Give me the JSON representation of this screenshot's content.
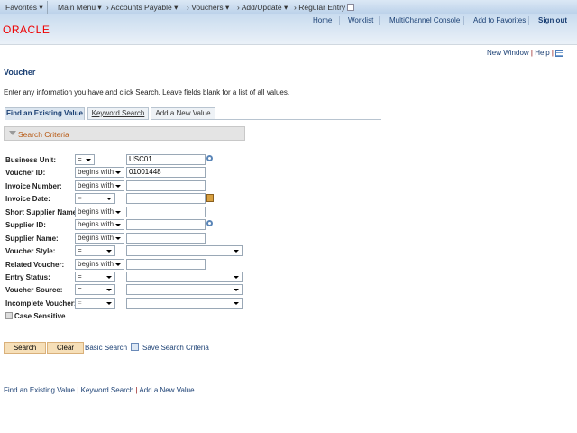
{
  "nav": {
    "favorites": "Favorites",
    "main_menu": "Main Menu",
    "breadcrumb": [
      "Accounts Payable",
      "Vouchers",
      "Add/Update",
      "Regular Entry"
    ]
  },
  "header": {
    "links": [
      "Home",
      "Worklist",
      "MultiChannel Console",
      "Add to Favorites"
    ],
    "sign_out": "Sign out",
    "logo": "ORACLE"
  },
  "toolbar": {
    "new_window": "New Window",
    "help": "Help"
  },
  "page": {
    "title": "Voucher",
    "instructions": "Enter any information you have and click Search. Leave fields blank for a list of all values."
  },
  "tabs": [
    "Find an Existing Value",
    "Keyword Search",
    "Add a New Value"
  ],
  "section": {
    "title": "Search Criteria"
  },
  "fields": [
    {
      "label": "Business Unit:",
      "op": "=",
      "value": "USC01"
    },
    {
      "label": "Voucher ID:",
      "op": "begins with",
      "value": "01001448"
    },
    {
      "label": "Invoice Number:",
      "op": "begins with",
      "value": ""
    },
    {
      "label": "Invoice Date:",
      "op": "=",
      "value": ""
    },
    {
      "label": "Short Supplier Name:",
      "op": "begins with",
      "value": ""
    },
    {
      "label": "Supplier ID:",
      "op": "begins with",
      "value": ""
    },
    {
      "label": "Supplier Name:",
      "op": "begins with",
      "value": ""
    },
    {
      "label": "Voucher Style:",
      "op": "=",
      "value": ""
    },
    {
      "label": "Related Voucher:",
      "op": "begins with",
      "value": ""
    },
    {
      "label": "Entry Status:",
      "op": "=",
      "value": ""
    },
    {
      "label": "Voucher Source:",
      "op": "=",
      "value": ""
    },
    {
      "label": "Incomplete Voucher:",
      "op": "=",
      "value": ""
    }
  ],
  "case_sensitive": {
    "label": "Case Sensitive",
    "checked": false
  },
  "buttons": {
    "search": "Search",
    "clear": "Clear",
    "basic_search": "Basic Search",
    "save_criteria": "Save Search Criteria"
  },
  "footer_links": [
    "Find an Existing Value",
    "Keyword Search",
    "Add a New Value"
  ]
}
